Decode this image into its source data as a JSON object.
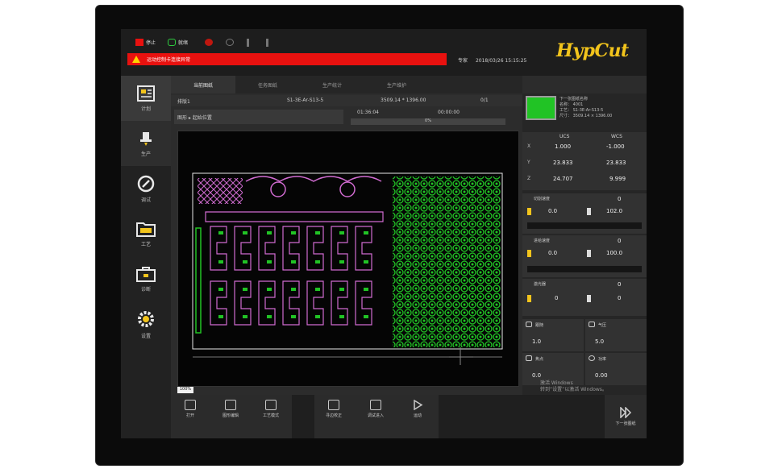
{
  "header": {
    "stop_label": "停止",
    "ready_label": "就绪",
    "alarm_text": "运动控制卡连接异常",
    "date_prefix": "专家",
    "date_time": "2018/03/26  15:15:25",
    "logo": "HypCut"
  },
  "sidebar": {
    "items": [
      {
        "label": "计划",
        "icon": "plan-icon"
      },
      {
        "label": "生产",
        "icon": "production-icon"
      },
      {
        "label": "调试",
        "icon": "debug-icon"
      },
      {
        "label": "工艺",
        "icon": "process-icon"
      },
      {
        "label": "诊断",
        "icon": "diagnose-icon"
      },
      {
        "label": "设置",
        "icon": "settings-gear-icon"
      }
    ]
  },
  "tabs": [
    {
      "label": "当前图纸"
    },
    {
      "label": "任务图纸"
    },
    {
      "label": "生产统计"
    },
    {
      "label": "生产维护"
    }
  ],
  "infobar": {
    "drawing": "排版1",
    "material": "S1-3E-Ar-S13-5",
    "size": "3509.14 * 1396.00",
    "count": "0/1"
  },
  "layer": {
    "label": "图形 ▸ 起始位置"
  },
  "progress": {
    "time": "01:36:04",
    "estimate": "00:00:00",
    "percent_text": "0%"
  },
  "thumbnail": {
    "line1": "下一张图纸名称",
    "line2": "名称：  4001",
    "line3": "工艺：  S1-3E-Ar-S13-5",
    "line4": "尺寸：  3509.14 × 1396.00"
  },
  "coords": {
    "ucs_label": "UCS",
    "wcs_label": "WCS",
    "rows": [
      {
        "axis": "X",
        "ucs": "1.000",
        "wcs": "-1.000"
      },
      {
        "axis": "Y",
        "ucs": "23.833",
        "wcs": "23.833"
      },
      {
        "axis": "Z",
        "ucs": "24.707",
        "wcs": "9.999"
      }
    ]
  },
  "blocks": [
    {
      "title": "切割速度",
      "top_val": "0",
      "left_val": "0.0",
      "right_val": "102.0"
    },
    {
      "title": "进给速度",
      "top_val": "0",
      "left_val": "0.0",
      "right_val": "100.0"
    },
    {
      "title": "激光器",
      "top_val": "0",
      "left_val": "0",
      "right_val": "0"
    }
  ],
  "small_cells": [
    {
      "title": "跟随",
      "value": "1.0"
    },
    {
      "title": "气压",
      "value": "5.0"
    },
    {
      "title": "焦点",
      "value": "0.0"
    },
    {
      "title": "功率",
      "value": "0.00"
    }
  ],
  "zoom_tag": "100%",
  "bottom_buttons": [
    {
      "label": "打开"
    },
    {
      "label": "图形编辑"
    },
    {
      "label": "工艺模式"
    },
    {
      "label": "寻边校正"
    },
    {
      "label": "调试进入"
    },
    {
      "label": "运动"
    }
  ],
  "next_button": "下一张图纸",
  "watermark": {
    "line1": "激活 Windows",
    "line2": "转到“设置”以激活 Windows。"
  },
  "colors": {
    "accent": "#f2c41c",
    "alarm": "#e8110f",
    "cut_green": "#21c325",
    "part_pink": "#d06bd0"
  }
}
